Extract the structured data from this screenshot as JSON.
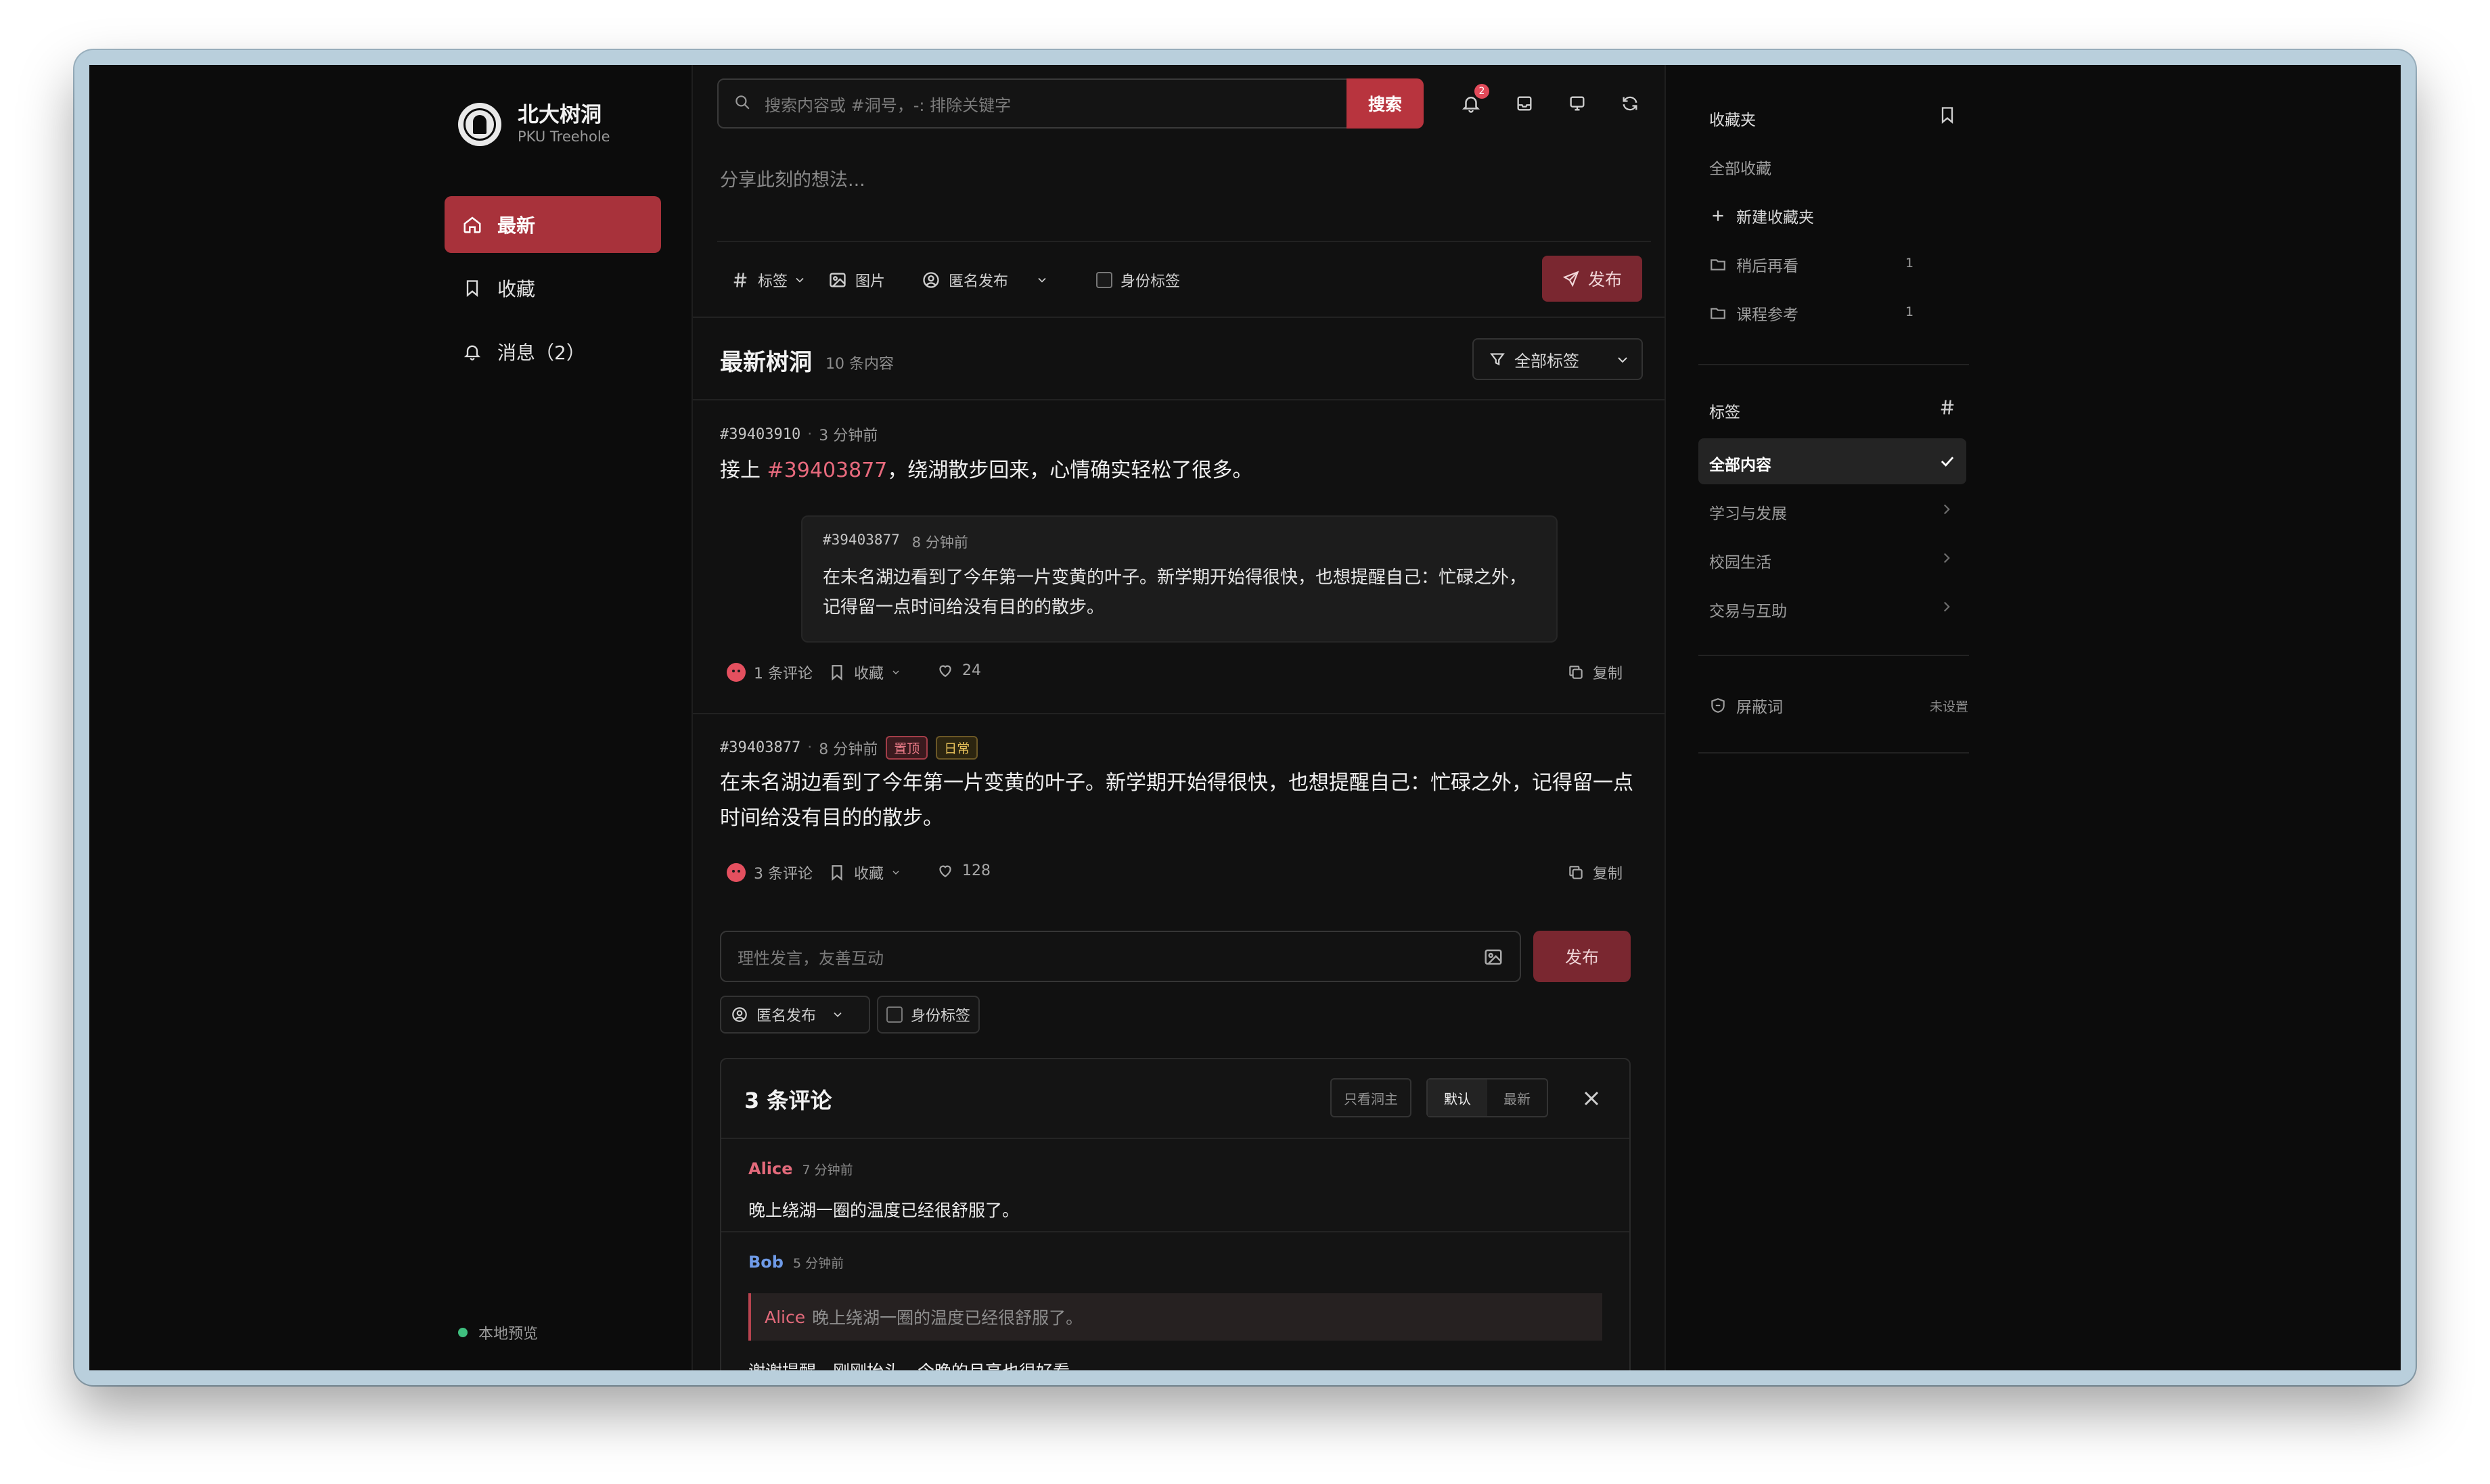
{
  "brand": {
    "title": "北大树洞",
    "subtitle": "PKU Treehole"
  },
  "nav": [
    {
      "label": "最新",
      "icon": "home-icon",
      "active": true
    },
    {
      "label": "收藏",
      "icon": "bookmark-icon"
    },
    {
      "label": "消息（2）",
      "icon": "bell-icon"
    }
  ],
  "footer": {
    "status": "本地预览"
  },
  "search": {
    "placeholder": "搜索内容或 #洞号，-: 排除关键字",
    "button": "搜索"
  },
  "notifications": {
    "count": "2"
  },
  "composer": {
    "placeholder": "分享此刻的想法...",
    "tag": "标签",
    "image": "图片",
    "anonymous": "匿名发布",
    "identity": "身份标签",
    "publish": "发布"
  },
  "feed": {
    "title": "最新树洞",
    "count": "10 条内容",
    "filter": "全部标签"
  },
  "posts": [
    {
      "id": "#39403910",
      "time": "3 分钟前",
      "text_prefix": "接上 ",
      "text_ref": "#39403877",
      "text_suffix": "，绕湖散步回来，心情确实轻松了很多。",
      "quote": {
        "id": "#39403877",
        "time": "8 分钟前",
        "text": "在未名湖边看到了今年第一片变黄的叶子。新学期开始得很快，也想提醒自己：忙碌之外，记得留一点时间给没有目的的散步。"
      },
      "comments": "1 条评论",
      "favorite": "收藏",
      "likes": "24",
      "copy": "复制"
    },
    {
      "id": "#39403877",
      "time": "8 分钟前",
      "tags": [
        "置顶",
        "日常"
      ],
      "text": "在未名湖边看到了今年第一片变黄的叶子。新学期开始得很快，也想提醒自己：忙碌之外，记得留一点时间给没有目的的散步。",
      "comments": "3 条评论",
      "favorite": "收藏",
      "likes": "128",
      "copy": "复制"
    }
  ],
  "reply": {
    "placeholder": "理性发言，友善互动",
    "publish": "发布",
    "anonymous": "匿名发布",
    "identity": "身份标签"
  },
  "comment_panel": {
    "title": "3 条评论",
    "only_op": "只看洞主",
    "sort_default": "默认",
    "sort_latest": "最新",
    "comments": [
      {
        "author": "Alice",
        "time": "7 分钟前",
        "text": "晚上绕湖一圈的温度已经很舒服了。"
      },
      {
        "author": "Bob",
        "time": "5 分钟前",
        "quote_author": "Alice",
        "quote_text": "晚上绕湖一圈的温度已经很舒服了。",
        "text": "谢谢提醒。刚刚抬头，今晚的月亮也很好看。"
      }
    ],
    "colors": {
      "alice": "#e36a7b",
      "bob": "#6f9be8"
    }
  },
  "right": {
    "favorites_title": "收藏夹",
    "all_favorites": "全部收藏",
    "new_folder": "新建收藏夹",
    "folders": [
      {
        "name": "稍后再看",
        "count": "1"
      },
      {
        "name": "课程参考",
        "count": "1"
      }
    ],
    "tags_title": "标签",
    "tags": [
      {
        "name": "全部内容",
        "selected": true
      },
      {
        "name": "学习与发展"
      },
      {
        "name": "校园生活"
      },
      {
        "name": "交易与互助"
      }
    ],
    "block_words": "屏蔽词",
    "block_status": "未设置"
  },
  "accent": "#b8343e"
}
